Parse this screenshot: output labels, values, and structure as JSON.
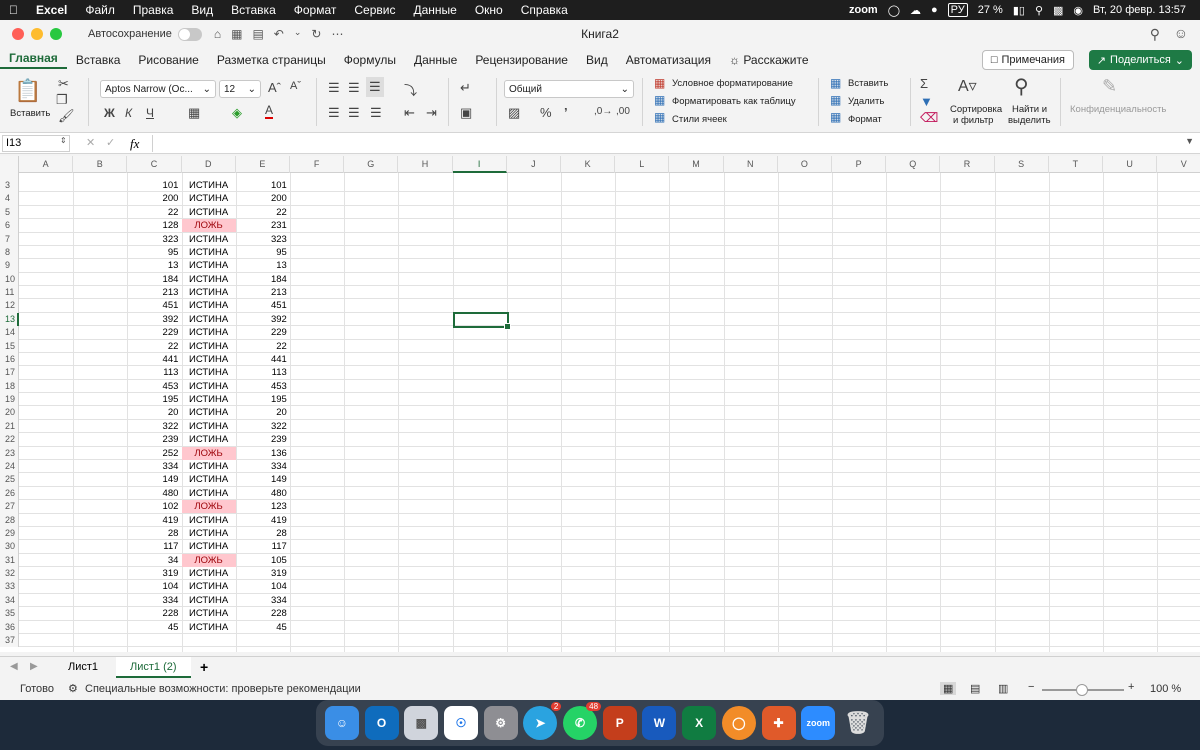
{
  "menubar": {
    "app": "Excel",
    "items": [
      "Файл",
      "Правка",
      "Вид",
      "Вставка",
      "Формат",
      "Сервис",
      "Данные",
      "Окно",
      "Справка"
    ],
    "zoom": "zoom",
    "lang": "РУ",
    "battery": "27 %",
    "datetime": "Вт, 20 февр.  13:57"
  },
  "titlebar": {
    "autosave": "Автосохранение",
    "title": "Книга2"
  },
  "tabs": {
    "items": [
      "Главная",
      "Вставка",
      "Рисование",
      "Разметка страницы",
      "Формулы",
      "Данные",
      "Рецензирование",
      "Вид",
      "Автоматизация",
      "Расскажите"
    ],
    "notes": "Примечания",
    "share": "Поделиться"
  },
  "ribbon": {
    "paste": "Вставить",
    "font": "Aptos Narrow (Ос...",
    "size": "12",
    "bold": "Ж",
    "italic": "К",
    "underline": "Ч",
    "format": "Общий",
    "cond": "Условное форматирование",
    "astable": "Форматировать как таблицу",
    "styles": "Стили ячеек",
    "insert": "Вставить",
    "delete": "Удалить",
    "formatcells": "Формат",
    "sort1": "Сортировка",
    "sort2": "и фильтр",
    "find1": "Найти и",
    "find2": "выделить",
    "privacy": "Конфиденциальность"
  },
  "formulabar": {
    "cellref": "I13",
    "fx": "fx"
  },
  "columns": [
    "A",
    "B",
    "C",
    "D",
    "E",
    "F",
    "G",
    "H",
    "I",
    "J",
    "K",
    "L",
    "M",
    "N",
    "O",
    "P",
    "Q",
    "R",
    "S",
    "T",
    "U",
    "V"
  ],
  "rows": [
    {
      "n": "3",
      "c": "101",
      "d": "ИСТИНА",
      "e": "101",
      "bad": false
    },
    {
      "n": "4",
      "c": "200",
      "d": "ИСТИНА",
      "e": "200",
      "bad": false
    },
    {
      "n": "5",
      "c": "22",
      "d": "ИСТИНА",
      "e": "22",
      "bad": false
    },
    {
      "n": "6",
      "c": "128",
      "d": "ЛОЖЬ",
      "e": "231",
      "bad": true
    },
    {
      "n": "7",
      "c": "323",
      "d": "ИСТИНА",
      "e": "323",
      "bad": false
    },
    {
      "n": "8",
      "c": "95",
      "d": "ИСТИНА",
      "e": "95",
      "bad": false
    },
    {
      "n": "9",
      "c": "13",
      "d": "ИСТИНА",
      "e": "13",
      "bad": false
    },
    {
      "n": "10",
      "c": "184",
      "d": "ИСТИНА",
      "e": "184",
      "bad": false
    },
    {
      "n": "11",
      "c": "213",
      "d": "ИСТИНА",
      "e": "213",
      "bad": false
    },
    {
      "n": "12",
      "c": "451",
      "d": "ИСТИНА",
      "e": "451",
      "bad": false
    },
    {
      "n": "13",
      "c": "392",
      "d": "ИСТИНА",
      "e": "392",
      "bad": false
    },
    {
      "n": "14",
      "c": "229",
      "d": "ИСТИНА",
      "e": "229",
      "bad": false
    },
    {
      "n": "15",
      "c": "22",
      "d": "ИСТИНА",
      "e": "22",
      "bad": false
    },
    {
      "n": "16",
      "c": "441",
      "d": "ИСТИНА",
      "e": "441",
      "bad": false
    },
    {
      "n": "17",
      "c": "113",
      "d": "ИСТИНА",
      "e": "113",
      "bad": false
    },
    {
      "n": "18",
      "c": "453",
      "d": "ИСТИНА",
      "e": "453",
      "bad": false
    },
    {
      "n": "19",
      "c": "195",
      "d": "ИСТИНА",
      "e": "195",
      "bad": false
    },
    {
      "n": "20",
      "c": "20",
      "d": "ИСТИНА",
      "e": "20",
      "bad": false
    },
    {
      "n": "21",
      "c": "322",
      "d": "ИСТИНА",
      "e": "322",
      "bad": false
    },
    {
      "n": "22",
      "c": "239",
      "d": "ИСТИНА",
      "e": "239",
      "bad": false
    },
    {
      "n": "23",
      "c": "252",
      "d": "ЛОЖЬ",
      "e": "136",
      "bad": true
    },
    {
      "n": "24",
      "c": "334",
      "d": "ИСТИНА",
      "e": "334",
      "bad": false
    },
    {
      "n": "25",
      "c": "149",
      "d": "ИСТИНА",
      "e": "149",
      "bad": false
    },
    {
      "n": "26",
      "c": "480",
      "d": "ИСТИНА",
      "e": "480",
      "bad": false
    },
    {
      "n": "27",
      "c": "102",
      "d": "ЛОЖЬ",
      "e": "123",
      "bad": true
    },
    {
      "n": "28",
      "c": "419",
      "d": "ИСТИНА",
      "e": "419",
      "bad": false
    },
    {
      "n": "29",
      "c": "28",
      "d": "ИСТИНА",
      "e": "28",
      "bad": false
    },
    {
      "n": "30",
      "c": "117",
      "d": "ИСТИНА",
      "e": "117",
      "bad": false
    },
    {
      "n": "31",
      "c": "34",
      "d": "ЛОЖЬ",
      "e": "105",
      "bad": true
    },
    {
      "n": "32",
      "c": "319",
      "d": "ИСТИНА",
      "e": "319",
      "bad": false
    },
    {
      "n": "33",
      "c": "104",
      "d": "ИСТИНА",
      "e": "104",
      "bad": false
    },
    {
      "n": "34",
      "c": "334",
      "d": "ИСТИНА",
      "e": "334",
      "bad": false
    },
    {
      "n": "35",
      "c": "228",
      "d": "ИСТИНА",
      "e": "228",
      "bad": false
    },
    {
      "n": "36",
      "c": "45",
      "d": "ИСТИНА",
      "e": "45",
      "bad": false
    },
    {
      "n": "37",
      "c": "",
      "d": "",
      "e": "",
      "bad": false
    }
  ],
  "selected": {
    "row": "13",
    "col": "I"
  },
  "sheets": {
    "tab1": "Лист1",
    "tab2": "Лист1 (2)",
    "add": "+"
  },
  "status": {
    "ready": "Готово",
    "access": "Специальные возможности: проверьте рекомендации",
    "zoom": "100 %"
  },
  "dock": {
    "telegram_badge": "2",
    "whatsapp_badge": "48",
    "zoom": "zoom"
  },
  "colors": {
    "accent": "#1e6b3a",
    "bad_fill": "#ffc7ce",
    "bad_text": "#9c0006"
  }
}
